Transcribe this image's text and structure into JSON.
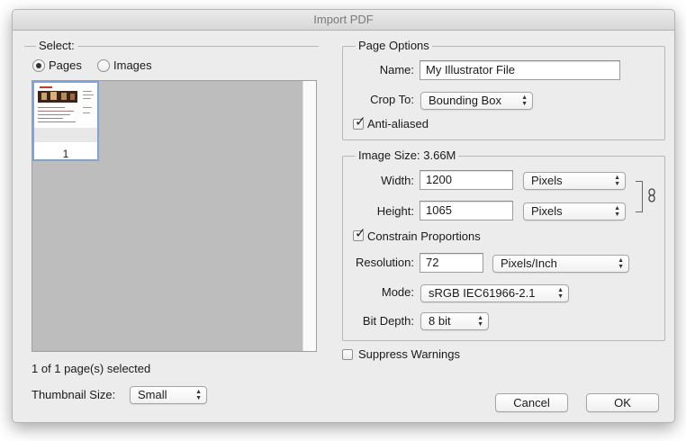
{
  "window": {
    "title": "Import PDF"
  },
  "select": {
    "legend": "Select:",
    "pages_label": "Pages",
    "images_label": "Images",
    "selected_option": "Pages",
    "thumbnail_page_number": "1",
    "status_text": "1 of 1 page(s) selected",
    "thumbnail_size_label": "Thumbnail Size:",
    "thumbnail_size_value": "Small"
  },
  "page_options": {
    "legend": "Page Options",
    "name_label": "Name:",
    "name_value": "My Illustrator File",
    "crop_to_label": "Crop To:",
    "crop_to_value": "Bounding Box",
    "anti_aliased_label": "Anti-aliased",
    "anti_aliased_checked": true
  },
  "image_size": {
    "legend": "Image Size: 3.66M",
    "width_label": "Width:",
    "width_value": "1200",
    "width_unit": "Pixels",
    "height_label": "Height:",
    "height_value": "1065",
    "height_unit": "Pixels",
    "link_icon": "chain-link-icon",
    "constrain_label": "Constrain Proportions",
    "constrain_checked": true,
    "resolution_label": "Resolution:",
    "resolution_value": "72",
    "resolution_unit": "Pixels/Inch",
    "mode_label": "Mode:",
    "mode_value": "sRGB IEC61966-2.1",
    "bit_depth_label": "Bit Depth:",
    "bit_depth_value": "8 bit"
  },
  "suppress_warnings_label": "Suppress Warnings",
  "suppress_warnings_checked": false,
  "buttons": {
    "cancel": "Cancel",
    "ok": "OK"
  },
  "colors": {
    "window_bg": "#ececec",
    "thumb_border": "#7fa3d6"
  }
}
